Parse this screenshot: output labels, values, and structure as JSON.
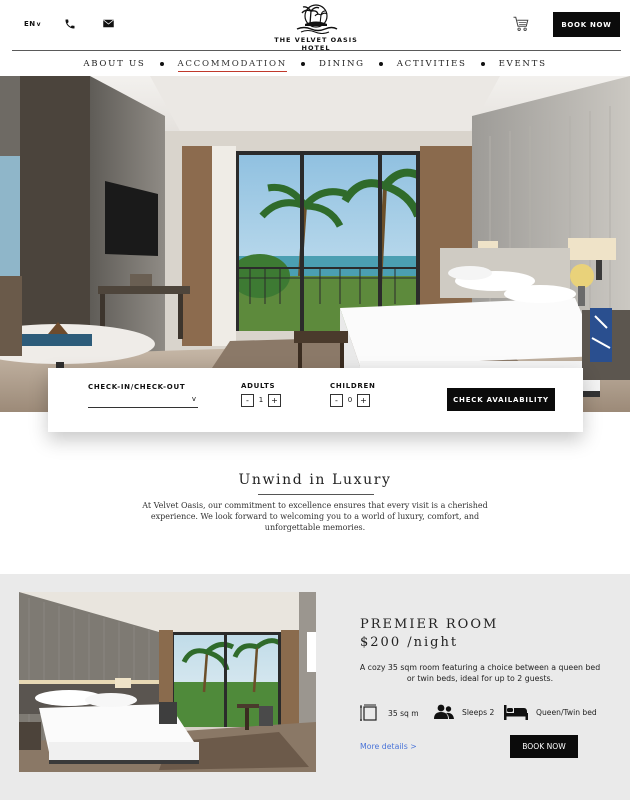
{
  "header": {
    "language": "EN",
    "language_chevron": "v",
    "hotel_name": "THE VELVET OASIS HOTEL",
    "book_now_label": "BOOK NOW"
  },
  "nav": {
    "items": [
      {
        "label": "ABOUT US",
        "active": false
      },
      {
        "label": "ACCOMMODATION",
        "active": true
      },
      {
        "label": "DINING",
        "active": false
      },
      {
        "label": "ACTIVITIES",
        "active": false
      },
      {
        "label": "EVENTS",
        "active": false
      }
    ]
  },
  "booking": {
    "checkin_label": "CHECK-IN/CHECK-OUT",
    "checkin_chevron": "v",
    "adults_label": "ADULTS",
    "adults_value": "1",
    "children_label": "CHILDREN",
    "children_value": "0",
    "minus": "-",
    "plus": "+",
    "check_availability_label": "CHECK AVAILABILITY"
  },
  "intro": {
    "title": "Unwind in Luxury",
    "text": "At Velvet Oasis, our commitment to excellence ensures that every visit is a cherished experience. We look forward to welcoming you to a world of luxury, comfort, and unforgettable memories."
  },
  "room": {
    "name": "PREMIER ROOM",
    "price": "$200 /night",
    "description": "A cozy 35 sqm room featuring a choice between a queen bed or twin beds, ideal for up to 2 guests.",
    "size": "35 sq m",
    "occupancy": "Sleeps 2",
    "bed": "Queen/Twin bed",
    "more_details_label": "More details >",
    "book_now_label": "BOOK NOW"
  },
  "colors": {
    "accent_underline": "#c0392b",
    "link": "#4a74d8",
    "button": "#0b0b0b",
    "section_bg": "#eaeaea"
  }
}
